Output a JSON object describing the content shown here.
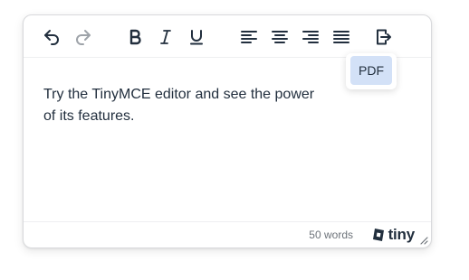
{
  "toolbar": {
    "buttons": [
      {
        "name": "undo",
        "icon": "undo-icon",
        "enabled": true
      },
      {
        "name": "redo",
        "icon": "redo-icon",
        "enabled": false
      },
      {
        "name": "bold",
        "icon": "bold-icon",
        "enabled": true
      },
      {
        "name": "italic",
        "icon": "italic-icon",
        "enabled": true
      },
      {
        "name": "underline",
        "icon": "underline-icon",
        "enabled": true
      },
      {
        "name": "align-left",
        "icon": "align-left-icon",
        "enabled": true
      },
      {
        "name": "align-center",
        "icon": "align-center-icon",
        "enabled": true
      },
      {
        "name": "align-right",
        "icon": "align-right-icon",
        "enabled": true
      },
      {
        "name": "justify",
        "icon": "align-justify-icon",
        "enabled": true
      },
      {
        "name": "export",
        "icon": "export-icon",
        "enabled": true
      }
    ]
  },
  "export_menu": {
    "items": [
      {
        "label": "PDF"
      }
    ]
  },
  "content": {
    "text": "Try the TinyMCE editor and see the power of its features."
  },
  "statusbar": {
    "word_count": "50 words",
    "brand": "tiny",
    "brand_icon": "tiny-logo-icon",
    "resize_icon": "resize-handle-icon"
  },
  "colors": {
    "text": "#222f3e",
    "icon": "#222f3e",
    "icon_disabled": "#9ea3a9",
    "menu_highlight": "#d3e1f7",
    "border": "#d8d9dc"
  }
}
